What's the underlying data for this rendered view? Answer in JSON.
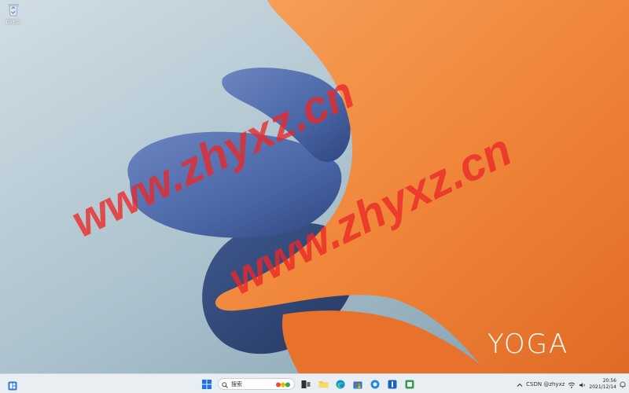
{
  "desktop": {
    "icons": [
      {
        "label": "回收站",
        "icon": "recycle-bin-icon"
      }
    ],
    "brand_text": "YOGA",
    "watermarks": [
      "www.zhyxz.cn",
      "www.zhyxz.cn"
    ],
    "colors": {
      "wallpaper_bg": "#a9c0cc",
      "orange": "#f08a3c",
      "blue": "#4a68a8"
    }
  },
  "taskbar": {
    "widgets_icon": "widgets-icon",
    "start_icon": "windows-start-icon",
    "search": {
      "placeholder": "搜索",
      "icon": "search-icon"
    },
    "pinned_apps": [
      {
        "name": "task-view",
        "icon": "task-view-icon"
      },
      {
        "name": "file-explorer",
        "icon": "folder-icon"
      },
      {
        "name": "edge",
        "icon": "edge-icon"
      },
      {
        "name": "store",
        "icon": "store-icon"
      },
      {
        "name": "browser",
        "icon": "browser-icon"
      },
      {
        "name": "app-blue",
        "icon": "app-icon"
      },
      {
        "name": "app-green",
        "icon": "app-icon"
      }
    ],
    "tray": {
      "text": "CSDN @zhyxz",
      "time": "20:56",
      "date": "2021/12/14"
    }
  }
}
